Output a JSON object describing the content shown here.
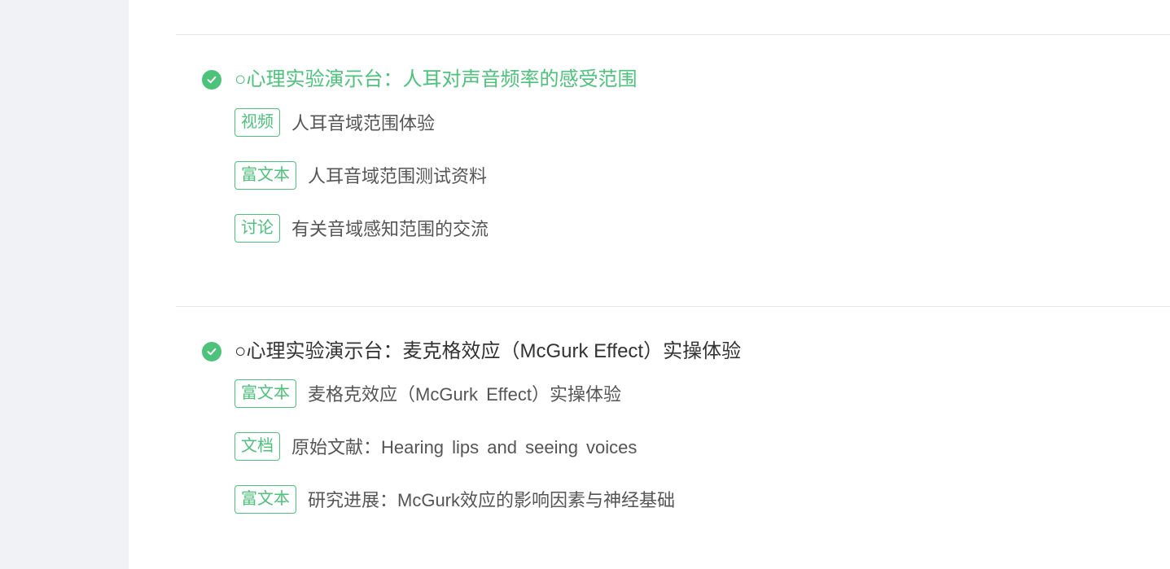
{
  "sections": [
    {
      "title": "○心理实验演示台：人耳对声音频率的感受范围",
      "active": true,
      "items": [
        {
          "tag": "视频",
          "label": "人耳音域范围体验"
        },
        {
          "tag": "富文本",
          "label": "人耳音域范围测试资料"
        },
        {
          "tag": "讨论",
          "label": "有关音域感知范围的交流"
        }
      ]
    },
    {
      "title": "○心理实验演示台：麦克格效应（McGurk Effect）实操体验",
      "active": false,
      "items": [
        {
          "tag": "富文本",
          "label": "麦格克效应（McGurk Effect）实操体验"
        },
        {
          "tag": "文档",
          "label": "原始文献：Hearing lips and seeing voices"
        },
        {
          "tag": "富文本",
          "label": "研究进展：McGurk效应的影响因素与神经基础"
        }
      ]
    }
  ],
  "icons": {
    "completed": "check-circle-icon"
  },
  "colors": {
    "accent": "#4cc27b",
    "text": "#333333",
    "muted": "#555555",
    "rail": "#f0f2f5",
    "divider": "#e6e6e6"
  }
}
